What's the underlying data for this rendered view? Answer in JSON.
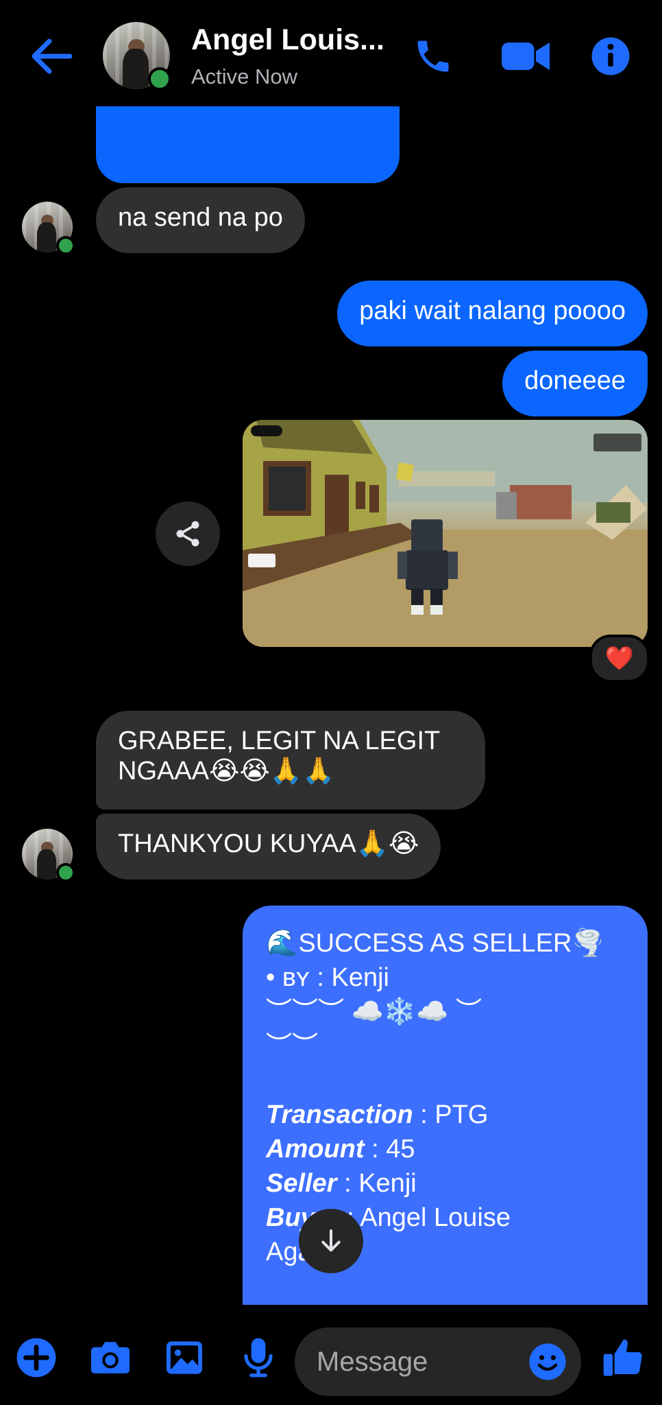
{
  "header": {
    "contact_name": "Angel Louis...",
    "status": "Active Now"
  },
  "messages": {
    "incoming_1": "na send na po",
    "outgoing_1": "paki wait nalang poooo",
    "outgoing_2": "doneeee",
    "image_reaction": "❤️",
    "incoming_2": "GRABEE, LEGIT NA LEGIT NGAAA😭😭🙏🙏",
    "incoming_3": "THANKYOU KUYAA🙏😭"
  },
  "seller_card": {
    "title": "🌊SUCCESS AS SELLER🌪️",
    "by_prefix": "• ʙʏ : ",
    "by_name": "Kenji",
    "decor_1": "︶︶︶ ☁️❄️☁️ ︶",
    "decor_2": "︶︶",
    "transaction_label": "Transaction",
    "transaction_value": " : PTG",
    "amount_label": "Amount",
    "amount_value": " : 45",
    "seller_label": "Seller",
    "seller_value": " : Kenji",
    "buyer_label": "Buyer",
    "buyer_value": " : Angel Louise",
    "buyer_value_2": "Agarro"
  },
  "composer": {
    "placeholder": "Message"
  },
  "colors": {
    "accent": "#0a66ff",
    "seller_card": "#3d6fff",
    "incoming_bubble": "#303030",
    "presence": "#31a24c"
  },
  "icons": [
    "back-arrow-icon",
    "phone-icon",
    "video-icon",
    "info-icon",
    "share-icon",
    "heart-icon",
    "arrow-down-icon",
    "plus-icon",
    "camera-icon",
    "image-icon",
    "microphone-icon",
    "emoji-icon",
    "thumbs-up-icon"
  ]
}
